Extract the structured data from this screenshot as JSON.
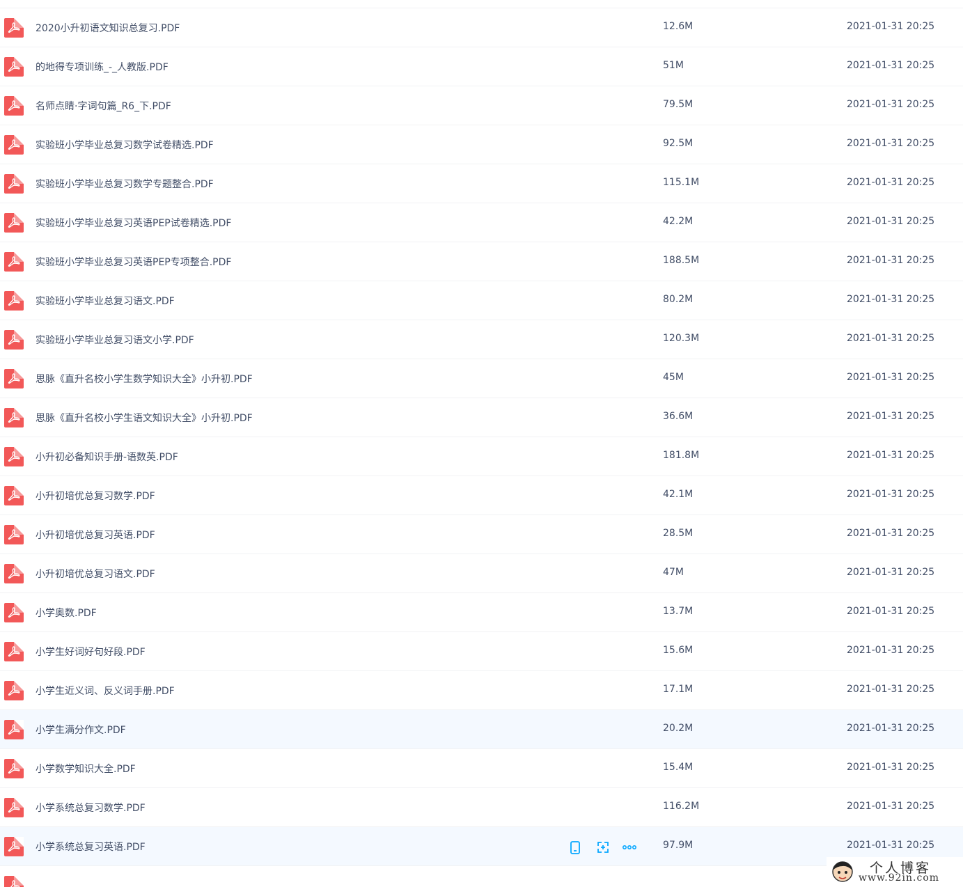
{
  "files": [
    {
      "name": "2020小升初语文知识总复习.PDF",
      "size": "12.6M",
      "time": "2021-01-31 20:25"
    },
    {
      "name": "的地得专项训练_-_人教版.PDF",
      "size": "51M",
      "time": "2021-01-31 20:25"
    },
    {
      "name": "名师点睛·字词句篇_R6_下.PDF",
      "size": "79.5M",
      "time": "2021-01-31 20:25"
    },
    {
      "name": "实验班小学毕业总复习数学试卷精选.PDF",
      "size": "92.5M",
      "time": "2021-01-31 20:25"
    },
    {
      "name": "实验班小学毕业总复习数学专题整合.PDF",
      "size": "115.1M",
      "time": "2021-01-31 20:25"
    },
    {
      "name": "实验班小学毕业总复习英语PEP试卷精选.PDF",
      "size": "42.2M",
      "time": "2021-01-31 20:25"
    },
    {
      "name": "实验班小学毕业总复习英语PEP专项整合.PDF",
      "size": "188.5M",
      "time": "2021-01-31 20:25"
    },
    {
      "name": "实验班小学毕业总复习语文.PDF",
      "size": "80.2M",
      "time": "2021-01-31 20:25"
    },
    {
      "name": "实验班小学毕业总复习语文小学.PDF",
      "size": "120.3M",
      "time": "2021-01-31 20:25"
    },
    {
      "name": "思脉《直升名校小学生数学知识大全》小升初.PDF",
      "size": "45M",
      "time": "2021-01-31 20:25"
    },
    {
      "name": "思脉《直升名校小学生语文知识大全》小升初.PDF",
      "size": "36.6M",
      "time": "2021-01-31 20:25"
    },
    {
      "name": "小升初必备知识手册-语数英.PDF",
      "size": "181.8M",
      "time": "2021-01-31 20:25"
    },
    {
      "name": "小升初培优总复习数学.PDF",
      "size": "42.1M",
      "time": "2021-01-31 20:25"
    },
    {
      "name": "小升初培优总复习英语.PDF",
      "size": "28.5M",
      "time": "2021-01-31 20:25"
    },
    {
      "name": "小升初培优总复习语文.PDF",
      "size": "47M",
      "time": "2021-01-31 20:25"
    },
    {
      "name": "小学奥数.PDF",
      "size": "13.7M",
      "time": "2021-01-31 20:25"
    },
    {
      "name": "小学生好词好句好段.PDF",
      "size": "15.6M",
      "time": "2021-01-31 20:25"
    },
    {
      "name": "小学生近义词、反义词手册.PDF",
      "size": "17.1M",
      "time": "2021-01-31 20:25"
    },
    {
      "name": "小学生满分作文.PDF",
      "size": "20.2M",
      "time": "2021-01-31 20:25"
    },
    {
      "name": "小学数学知识大全.PDF",
      "size": "15.4M",
      "time": "2021-01-31 20:25"
    },
    {
      "name": "小学系统总复习数学.PDF",
      "size": "116.2M",
      "time": "2021-01-31 20:25"
    },
    {
      "name": "小学系统总复习英语.PDF",
      "size": "97.9M",
      "time": "2021-01-31 20:25"
    }
  ],
  "highlighted_rows": [
    18,
    21
  ],
  "hover_row": 21,
  "icons": {
    "file": "pdf-file-icon",
    "actions": [
      "phone-icon",
      "share-link-icon",
      "more-icon"
    ]
  },
  "colors": {
    "pdf": "#f25858",
    "action": "#06a7ff",
    "hover_bg": "#f4f9ff"
  },
  "watermark": {
    "line1": "个人博客",
    "line2": "www.92in.com"
  }
}
